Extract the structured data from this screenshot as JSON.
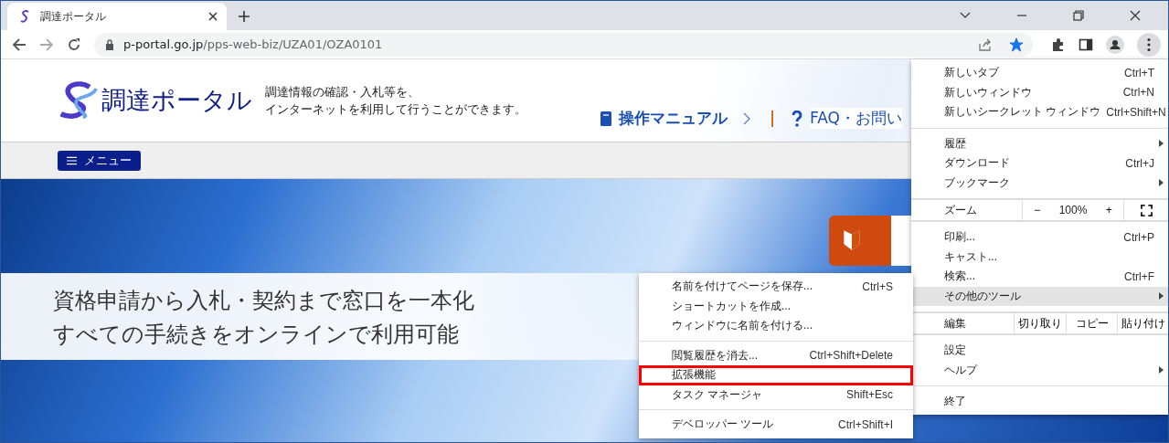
{
  "browser": {
    "tab": {
      "title": "調達ポータル"
    },
    "address": {
      "domain": "p-portal.go.jp",
      "path": "/pps-web-biz/UZA01/OZA0101"
    },
    "bookmarked": true
  },
  "page": {
    "logo_text": "調達ポータル",
    "tagline": [
      "調達情報の確認・入札等を、",
      "インターネットを利用して行うことができます。"
    ],
    "header_links": [
      {
        "kind": "manual",
        "label": "操作マニュアル"
      },
      {
        "kind": "faq",
        "label": "FAQ・お問い"
      }
    ],
    "menu_button": "メニュー",
    "banner": [
      "資格申請から入札・契約まで窓口を一本化",
      "すべての手続きをオンラインで利用可能"
    ]
  },
  "main_menu": {
    "groups": [
      [
        {
          "kind": "item",
          "label": "新しいタブ",
          "shortcut": "Ctrl+T",
          "submenu": false,
          "selected": false
        },
        {
          "kind": "item",
          "label": "新しいウィンドウ",
          "shortcut": "Ctrl+N",
          "submenu": false,
          "selected": false
        },
        {
          "kind": "item",
          "label": "新しいシークレット ウィンドウ",
          "shortcut": "Ctrl+Shift+N",
          "submenu": false,
          "selected": false
        }
      ],
      [
        {
          "kind": "item",
          "label": "履歴",
          "submenu": true,
          "selected": false
        },
        {
          "kind": "item",
          "label": "ダウンロード",
          "shortcut": "Ctrl+J",
          "submenu": false,
          "selected": false
        },
        {
          "kind": "item",
          "label": "ブックマーク",
          "submenu": true,
          "selected": false
        }
      ],
      [
        {
          "kind": "zoom",
          "label": "ズーム",
          "minus": "−",
          "value": "100%",
          "plus": "+"
        }
      ],
      [
        {
          "kind": "item",
          "label": "印刷...",
          "shortcut": "Ctrl+P",
          "submenu": false,
          "selected": false
        },
        {
          "kind": "item",
          "label": "キャスト...",
          "submenu": false,
          "selected": false
        },
        {
          "kind": "item",
          "label": "検索...",
          "shortcut": "Ctrl+F",
          "submenu": false,
          "selected": false
        },
        {
          "kind": "item",
          "label": "その他のツール",
          "submenu": true,
          "selected": true
        }
      ],
      [
        {
          "kind": "edit",
          "label": "編集",
          "actions": [
            "切り取り",
            "コピー",
            "貼り付け"
          ]
        }
      ],
      [
        {
          "kind": "item",
          "label": "設定",
          "submenu": false,
          "selected": false
        },
        {
          "kind": "item",
          "label": "ヘルプ",
          "submenu": true,
          "selected": false
        }
      ],
      [
        {
          "kind": "item",
          "label": "終了",
          "submenu": false,
          "selected": false
        }
      ]
    ]
  },
  "sub_menu": {
    "groups": [
      [
        {
          "label": "名前を付けてページを保存...",
          "shortcut": "Ctrl+S",
          "highlighted": false
        },
        {
          "label": "ショートカットを作成...",
          "highlighted": false
        },
        {
          "label": "ウィンドウに名前を付ける...",
          "highlighted": false
        }
      ],
      [
        {
          "label": "閲覧履歴を消去...",
          "shortcut": "Ctrl+Shift+Delete",
          "highlighted": false
        },
        {
          "label": "拡張機能",
          "highlighted": true
        },
        {
          "label": "タスク マネージャ",
          "shortcut": "Shift+Esc",
          "highlighted": false
        }
      ],
      [
        {
          "label": "デベロッパー ツール",
          "shortcut": "Ctrl+Shift+I",
          "highlighted": false
        }
      ]
    ]
  }
}
